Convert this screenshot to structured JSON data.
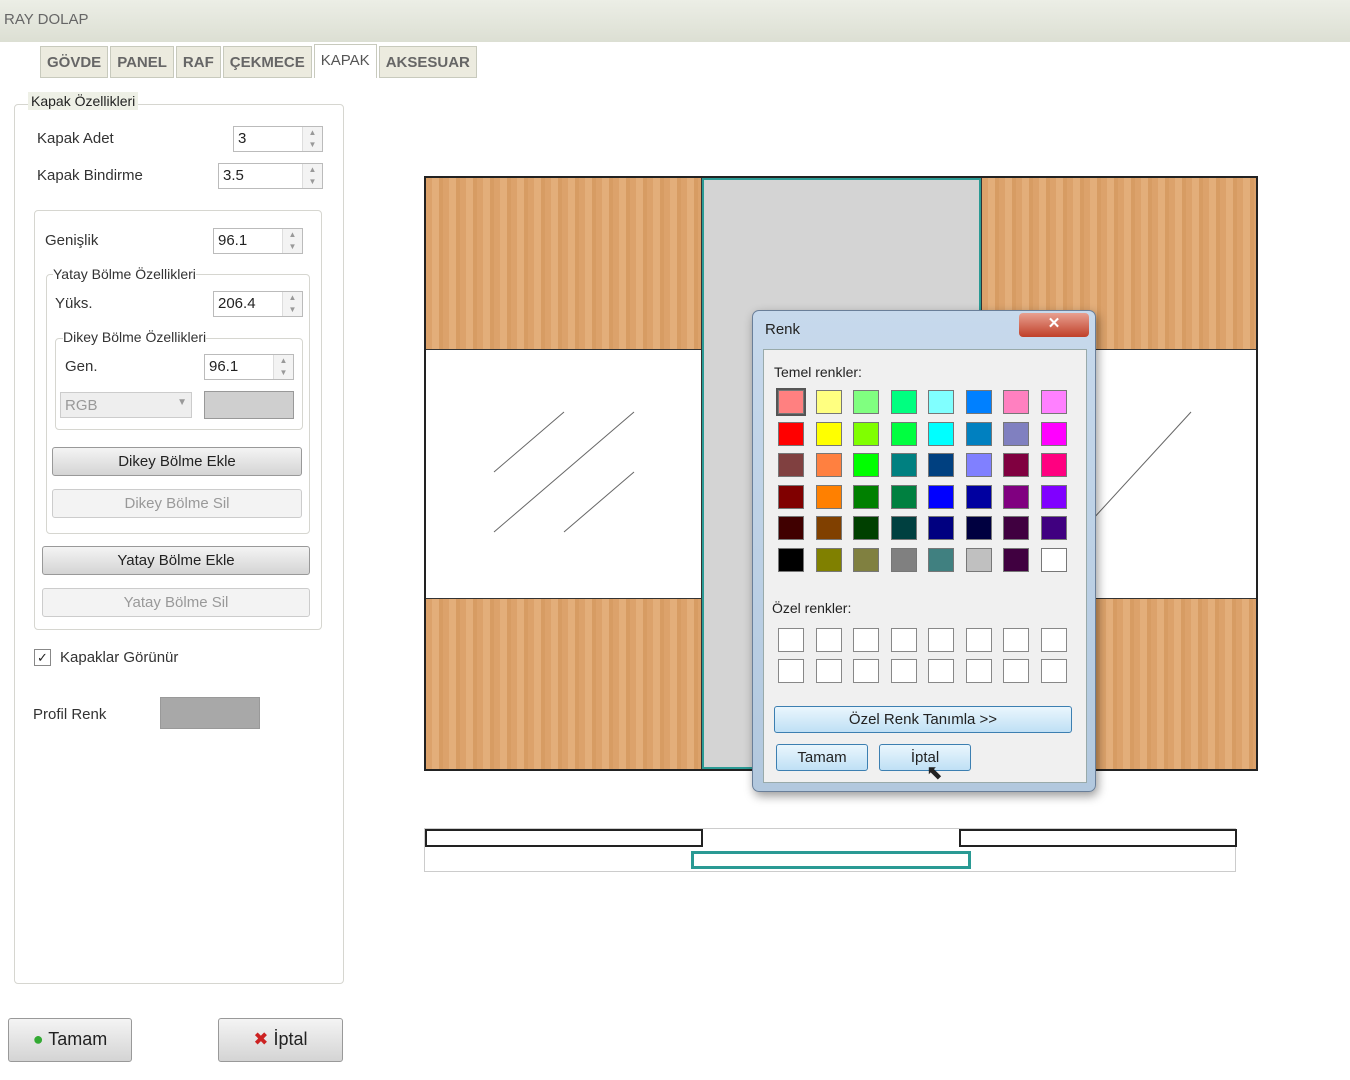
{
  "window": {
    "title": "RAY DOLAP"
  },
  "tabs": [
    {
      "label": "GÖVDE"
    },
    {
      "label": "PANEL"
    },
    {
      "label": "RAF"
    },
    {
      "label": "ÇEKMECE"
    },
    {
      "label": "KAPAK",
      "active": true
    },
    {
      "label": "AKSESUAR"
    }
  ],
  "panel": {
    "group_title": "Kapak Özellikleri",
    "kapak_adet_label": "Kapak Adet",
    "kapak_adet": "3",
    "kapak_bindirme_label": "Kapak Bindirme",
    "kapak_bindirme": "3.5",
    "genislik_label": "Genişlik",
    "genislik": "96.1",
    "yatay_group": "Yatay Bölme Özellikleri",
    "yuks_label": "Yüks.",
    "yuks": "206.4",
    "dikey_group": "Dikey Bölme Özellikleri",
    "gen_label": "Gen.",
    "gen": "96.1",
    "color_mode": "RGB",
    "dikey_ekle": "Dikey Bölme Ekle",
    "dikey_sil": "Dikey Bölme Sil",
    "yatay_ekle": "Yatay Bölme Ekle",
    "yatay_sil": "Yatay Bölme Sil",
    "kapaklar_gorunur": "Kapaklar Görünür",
    "kapaklar_checked": true,
    "profil_renk_label": "Profil Renk",
    "profil_renk": "#a8a8a8"
  },
  "footer": {
    "ok": "Tamam",
    "cancel": "İptal"
  },
  "dialog": {
    "title": "Renk",
    "basic_label": "Temel renkler:",
    "custom_label": "Özel renkler:",
    "define_custom": "Özel Renk Tanımla >>",
    "ok": "Tamam",
    "cancel": "İptal",
    "basic_colors": [
      "#FF8080",
      "#FFFF80",
      "#80FF80",
      "#00FF80",
      "#80FFFF",
      "#0080FF",
      "#FF80C0",
      "#FF80FF",
      "#FF0000",
      "#FFFF00",
      "#80FF00",
      "#00FF40",
      "#00FFFF",
      "#0080C0",
      "#8080C0",
      "#FF00FF",
      "#804040",
      "#FF8040",
      "#00FF00",
      "#008080",
      "#004080",
      "#8080FF",
      "#800040",
      "#FF0080",
      "#800000",
      "#FF8000",
      "#008000",
      "#008040",
      "#0000FF",
      "#0000A0",
      "#800080",
      "#8000FF",
      "#400000",
      "#804000",
      "#004000",
      "#004040",
      "#000080",
      "#000040",
      "#400040",
      "#400080",
      "#000000",
      "#808000",
      "#808040",
      "#808080",
      "#408080",
      "#C0C0C0",
      "#400040",
      "#FFFFFF"
    ],
    "selected_index": 0
  }
}
